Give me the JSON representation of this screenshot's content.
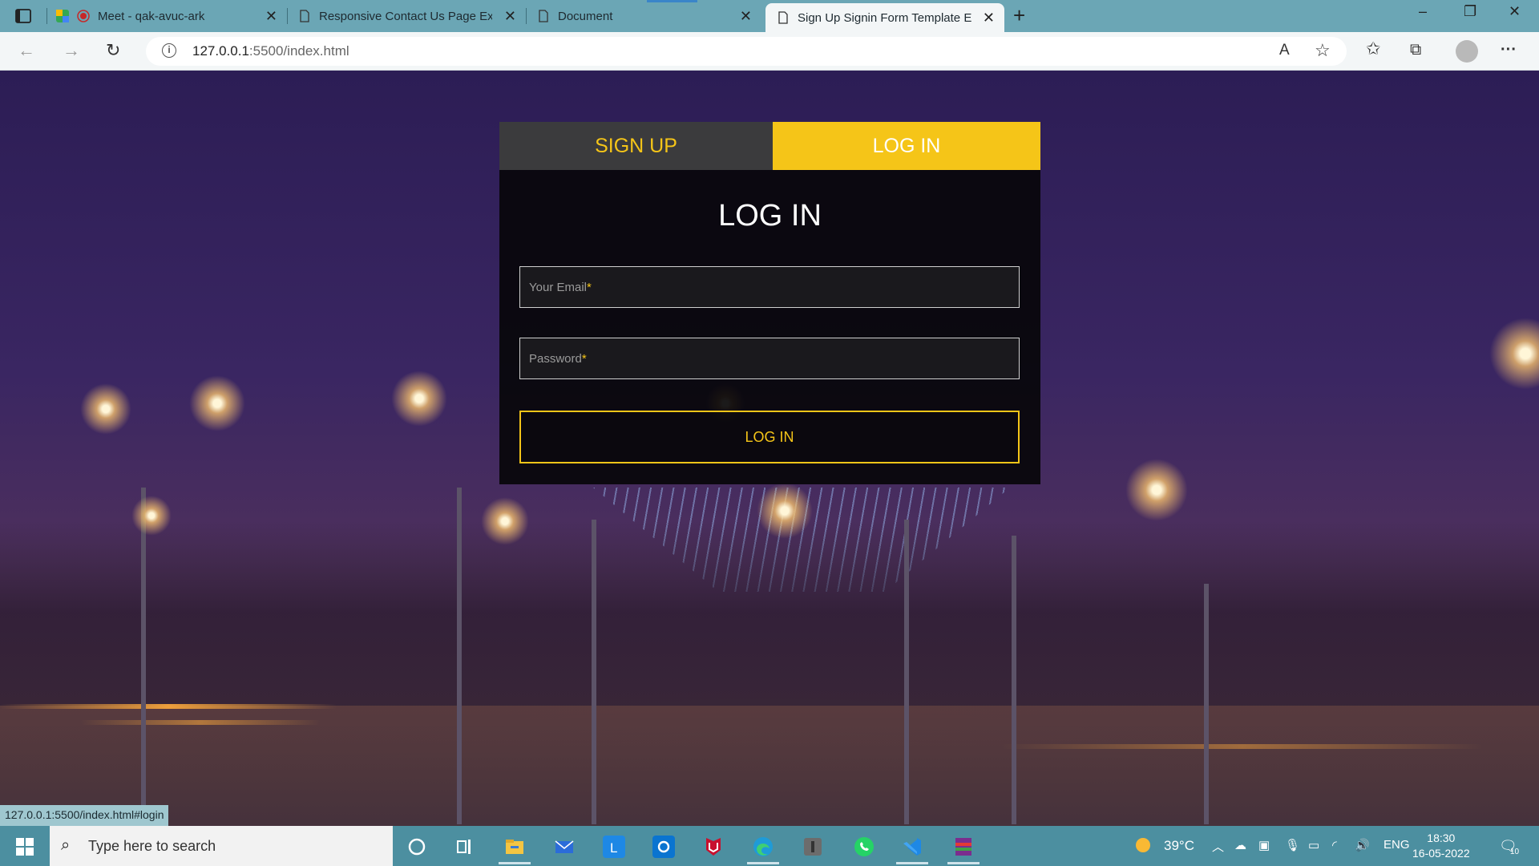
{
  "browser": {
    "tabs": [
      {
        "title": "Meet - qak-avuc-ark",
        "close": "✕"
      },
      {
        "title": "Responsive Contact Us Page Exa",
        "close": "✕"
      },
      {
        "title": "Document",
        "close": "✕"
      },
      {
        "title": "Sign Up Signin Form Template E",
        "close": "✕"
      }
    ],
    "new_tab": "+",
    "window_controls": {
      "minimize": "–",
      "restore": "❐",
      "close": "✕"
    },
    "nav": {
      "back": "←",
      "forward": "→",
      "reload": "↻"
    },
    "url": {
      "host": "127.0.0.1",
      "rest": ":5500/index.html"
    },
    "toolbar": {
      "read_aloud": "A",
      "favorite": "☆",
      "favorites": "✩",
      "collections": "⧉",
      "menu": "···"
    }
  },
  "form": {
    "tabs": {
      "signup": "SIGN UP",
      "login": "LOG IN"
    },
    "title": "LOG IN",
    "email_placeholder": "Your Email",
    "password_placeholder": "Password",
    "required_mark": "*",
    "submit_label": "LOG IN",
    "accent_color": "#f5c518"
  },
  "status_bar": {
    "hover_url": "127.0.0.1:5500/index.html#login"
  },
  "taskbar": {
    "search_placeholder": "Type here to search",
    "weather": "39°C",
    "language": "ENG",
    "time": "18:30",
    "date": "16-05-2022",
    "notifications": "10"
  }
}
